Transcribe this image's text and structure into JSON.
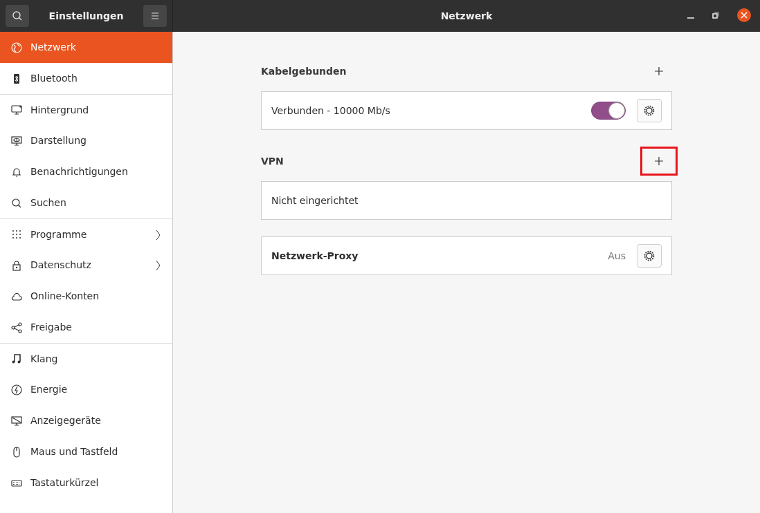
{
  "header": {
    "sidebar_title": "Einstellungen",
    "title": "Netzwerk"
  },
  "sidebar": {
    "groups": [
      {
        "items": [
          {
            "label": "Netzwerk",
            "selected": true,
            "arrow": false
          },
          {
            "label": "Bluetooth",
            "selected": false,
            "arrow": false
          }
        ]
      },
      {
        "items": [
          {
            "label": "Hintergrund",
            "selected": false,
            "arrow": false
          },
          {
            "label": "Darstellung",
            "selected": false,
            "arrow": false
          },
          {
            "label": "Benachrichtigungen",
            "selected": false,
            "arrow": false
          },
          {
            "label": "Suchen",
            "selected": false,
            "arrow": false
          }
        ]
      },
      {
        "items": [
          {
            "label": "Programme",
            "selected": false,
            "arrow": true
          },
          {
            "label": "Datenschutz",
            "selected": false,
            "arrow": true
          },
          {
            "label": "Online-Konten",
            "selected": false,
            "arrow": false
          },
          {
            "label": "Freigabe",
            "selected": false,
            "arrow": false
          }
        ]
      },
      {
        "items": [
          {
            "label": "Klang",
            "selected": false,
            "arrow": false
          },
          {
            "label": "Energie",
            "selected": false,
            "arrow": false
          },
          {
            "label": "Anzeigegeräte",
            "selected": false,
            "arrow": false
          },
          {
            "label": "Maus und Tastfeld",
            "selected": false,
            "arrow": false
          },
          {
            "label": "Tastaturkürzel",
            "selected": false,
            "arrow": false
          }
        ]
      }
    ]
  },
  "sections": [
    {
      "kind": "list",
      "title": "Kabelgebunden",
      "add_highlighted": false,
      "rows": [
        {
          "label": "Verbunden - 10000 Mb/s",
          "bold": false,
          "switch_on": true,
          "status": null,
          "settings": true
        }
      ]
    },
    {
      "kind": "list",
      "title": "VPN",
      "add_highlighted": true,
      "rows": [
        {
          "label": "Nicht eingerichtet",
          "bold": false,
          "switch_on": null,
          "status": null,
          "settings": false
        }
      ]
    },
    {
      "kind": "plain",
      "rows": [
        {
          "label": "Netzwerk-Proxy",
          "bold": true,
          "switch_on": null,
          "status": "Aus",
          "settings": true
        }
      ]
    }
  ]
}
